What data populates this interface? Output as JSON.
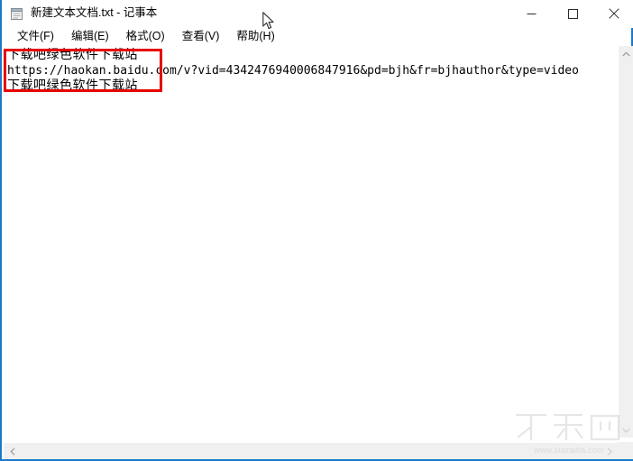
{
  "window": {
    "title": "新建文本文档.txt - 记事本",
    "icon": "notepad-icon",
    "border_color": "#1979ca",
    "controls": {
      "minimize_label": "最小化",
      "maximize_label": "最大化",
      "close_label": "关闭"
    }
  },
  "menubar": {
    "items": [
      {
        "label": "文件(F)",
        "name": "menu-file"
      },
      {
        "label": "编辑(E)",
        "name": "menu-edit"
      },
      {
        "label": "格式(O)",
        "name": "menu-format"
      },
      {
        "label": "查看(V)",
        "name": "menu-view"
      },
      {
        "label": "帮助(H)",
        "name": "menu-help"
      }
    ]
  },
  "editor": {
    "lines": [
      {
        "text": "下载吧绿色软件下载站",
        "script": "cjk"
      },
      {
        "text": "https://haokan.baidu.com/v?vid=4342476940006847916&pd=bjh&fr=bjhauthor&type=video",
        "script": "latin"
      },
      {
        "text": "下载吧绿色软件下载站",
        "script": "cjk"
      }
    ]
  },
  "annotation": {
    "type": "red-rectangle-highlight",
    "color": "#e60000"
  },
  "scrollbars": {
    "vertical": {
      "up_arrow": "chevron-up-icon",
      "down_arrow": "chevron-down-icon"
    },
    "horizontal": {
      "left_arrow": "chevron-left-icon",
      "right_arrow": "chevron-right-icon"
    }
  },
  "watermark": {
    "logo_text": "下载吧",
    "url": "www.xiazaiba.com"
  },
  "cursor": {
    "type": "arrow-pointer"
  }
}
